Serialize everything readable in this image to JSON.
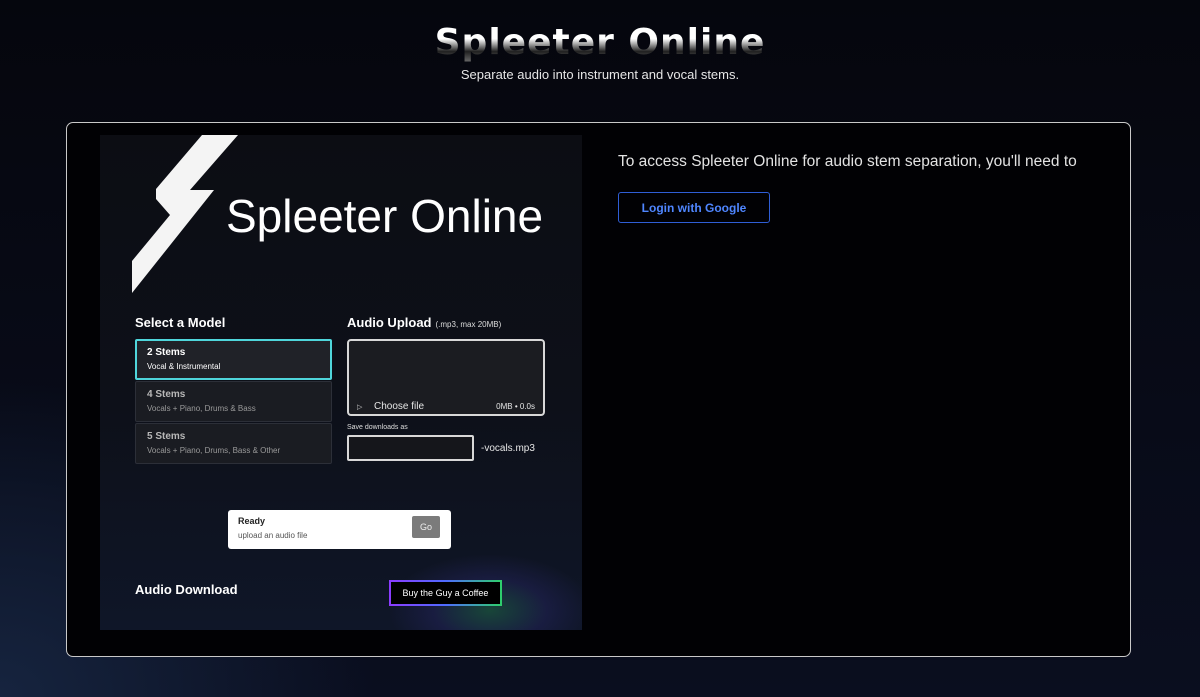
{
  "header": {
    "title": "Spleeter Online",
    "subtitle": "Separate audio into instrument and vocal stems."
  },
  "preview": {
    "logo_text": "Spleeter Online",
    "select_model_heading": "Select a Model",
    "models": [
      {
        "name": "2 Stems",
        "desc": "Vocal & Instrumental",
        "selected": true
      },
      {
        "name": "4 Stems",
        "desc": "Vocals + Piano, Drums & Bass",
        "selected": false
      },
      {
        "name": "5 Stems",
        "desc": "Vocals + Piano, Drums, Bass & Other",
        "selected": false
      }
    ],
    "upload_heading": "Audio Upload",
    "upload_hint": "(.mp3, max 20MB)",
    "choose_file": "Choose file",
    "file_meta": "0MB • 0.0s",
    "save_label": "Save downloads as",
    "save_suffix": "-vocals.mp3",
    "status_title": "Ready",
    "status_desc": "upload an audio file",
    "go_label": "Go",
    "download_heading": "Audio Download",
    "coffee_label": "Buy the Guy a Coffee"
  },
  "auth": {
    "message": "To access Spleeter Online for audio stem separation, you'll need to",
    "login_label": "Login with Google"
  },
  "colors": {
    "accent_selected": "#4fd6db",
    "login_blue": "#4f86ff"
  }
}
